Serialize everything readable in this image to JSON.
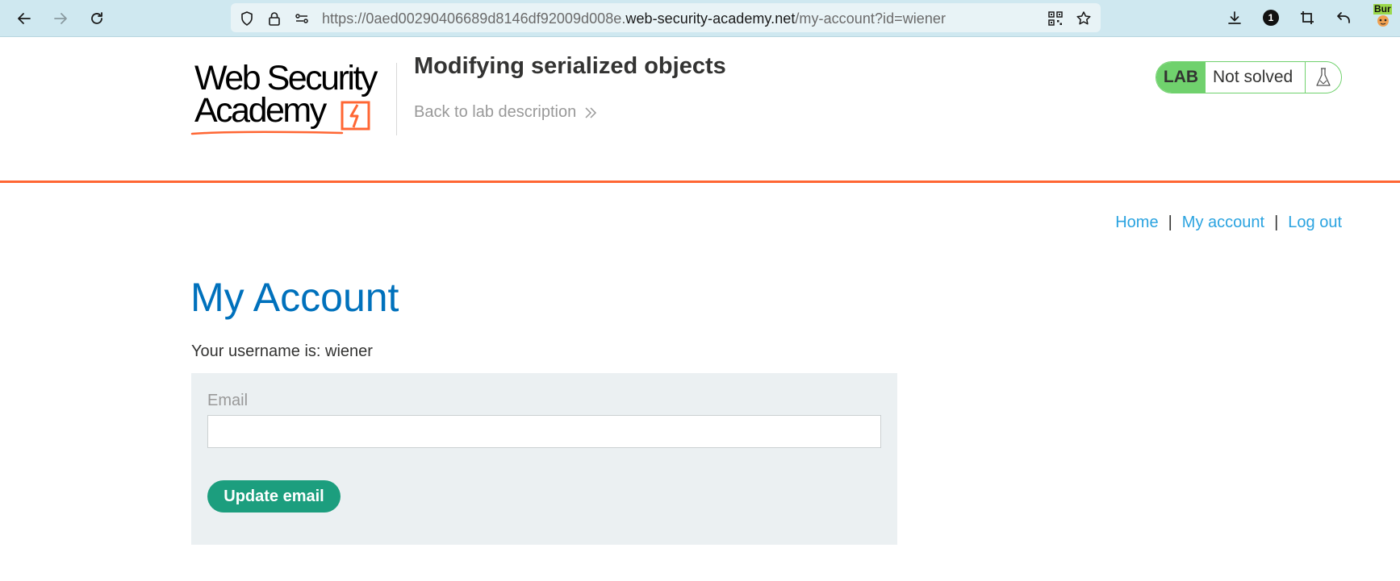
{
  "browser": {
    "url_prefix": "https://0aed00290406689d8146df92009d008e.",
    "url_host": "web-security-academy.net",
    "url_path": "/my-account?id=wiener",
    "extension_badge": "1",
    "burp_label": "Bur"
  },
  "header": {
    "logo_line1": "Web Security",
    "logo_line2": "Academy",
    "lab_title": "Modifying serialized objects",
    "back_link": "Back to lab description",
    "lab_tag": "LAB",
    "lab_status": "Not solved"
  },
  "colors": {
    "accent_orange": "#ff6633",
    "lab_green": "#70d16d",
    "heading_blue": "#0071bc",
    "link_blue": "#2aa3e0",
    "button_green": "#1c9e7e",
    "panel_bg": "#ebf0f2"
  },
  "nav": {
    "links": [
      {
        "label": "Home"
      },
      {
        "label": "My account"
      },
      {
        "label": "Log out"
      }
    ],
    "separator": "|"
  },
  "main": {
    "heading": "My Account",
    "username_text": "Your username is: wiener",
    "email_label": "Email",
    "email_value": "",
    "update_button": "Update email"
  }
}
